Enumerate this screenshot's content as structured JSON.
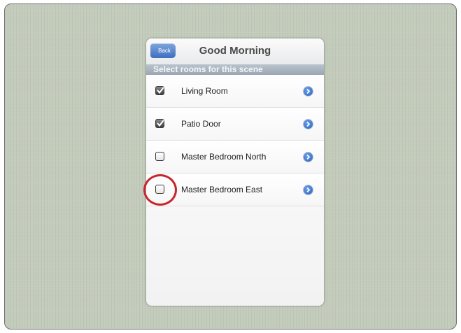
{
  "navbar": {
    "back_label": "Back",
    "title": "Good Morning"
  },
  "section": {
    "header": "Select rooms for this scene"
  },
  "rooms": [
    {
      "label": "Living Room",
      "checked": true
    },
    {
      "label": "Patio Door",
      "checked": true
    },
    {
      "label": "Master Bedroom North",
      "checked": false
    },
    {
      "label": "Master Bedroom East",
      "checked": false
    }
  ],
  "colors": {
    "accent_blue": "#3d6fc0",
    "highlight_ring": "#c8262e",
    "background": "#c3cbbb"
  }
}
